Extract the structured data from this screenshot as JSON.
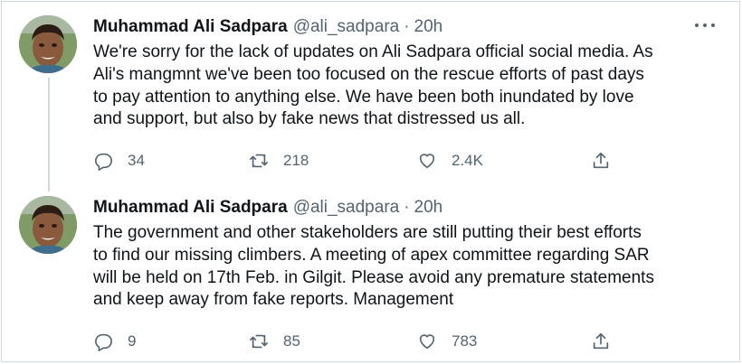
{
  "tweets": [
    {
      "author_name": "Muhammad Ali Sadpara",
      "handle": "@ali_sadpara",
      "separator": "·",
      "time": "20h",
      "text_lines": [
        "We're sorry for the lack of updates on Ali Sadpara official social media. As",
        "Ali's mangmnt we've been too focused on the rescue efforts of past days",
        "to pay attention to anything else. We have been both inundated by love",
        "and support, but also by fake news that distressed us all."
      ],
      "replies": "34",
      "retweets": "218",
      "likes": "2.4K"
    },
    {
      "author_name": "Muhammad Ali Sadpara",
      "handle": "@ali_sadpara",
      "separator": "·",
      "time": "20h",
      "text_lines": [
        "The government and other stakeholders are still putting their best efforts",
        "to find our missing climbers. A meeting of apex committee regarding SAR",
        "will be held on 17th Feb. in Gilgit. Please avoid any premature statements",
        "and keep away from fake reports. Management"
      ],
      "replies": "9",
      "retweets": "85",
      "likes": "783"
    }
  ],
  "icons": {
    "reply": "reply-icon",
    "retweet": "retweet-icon",
    "like": "heart-icon",
    "share": "share-icon",
    "more": "more-icon"
  },
  "colors": {
    "text": "#0f1419",
    "secondary": "#536471",
    "border": "#cfd9de"
  }
}
